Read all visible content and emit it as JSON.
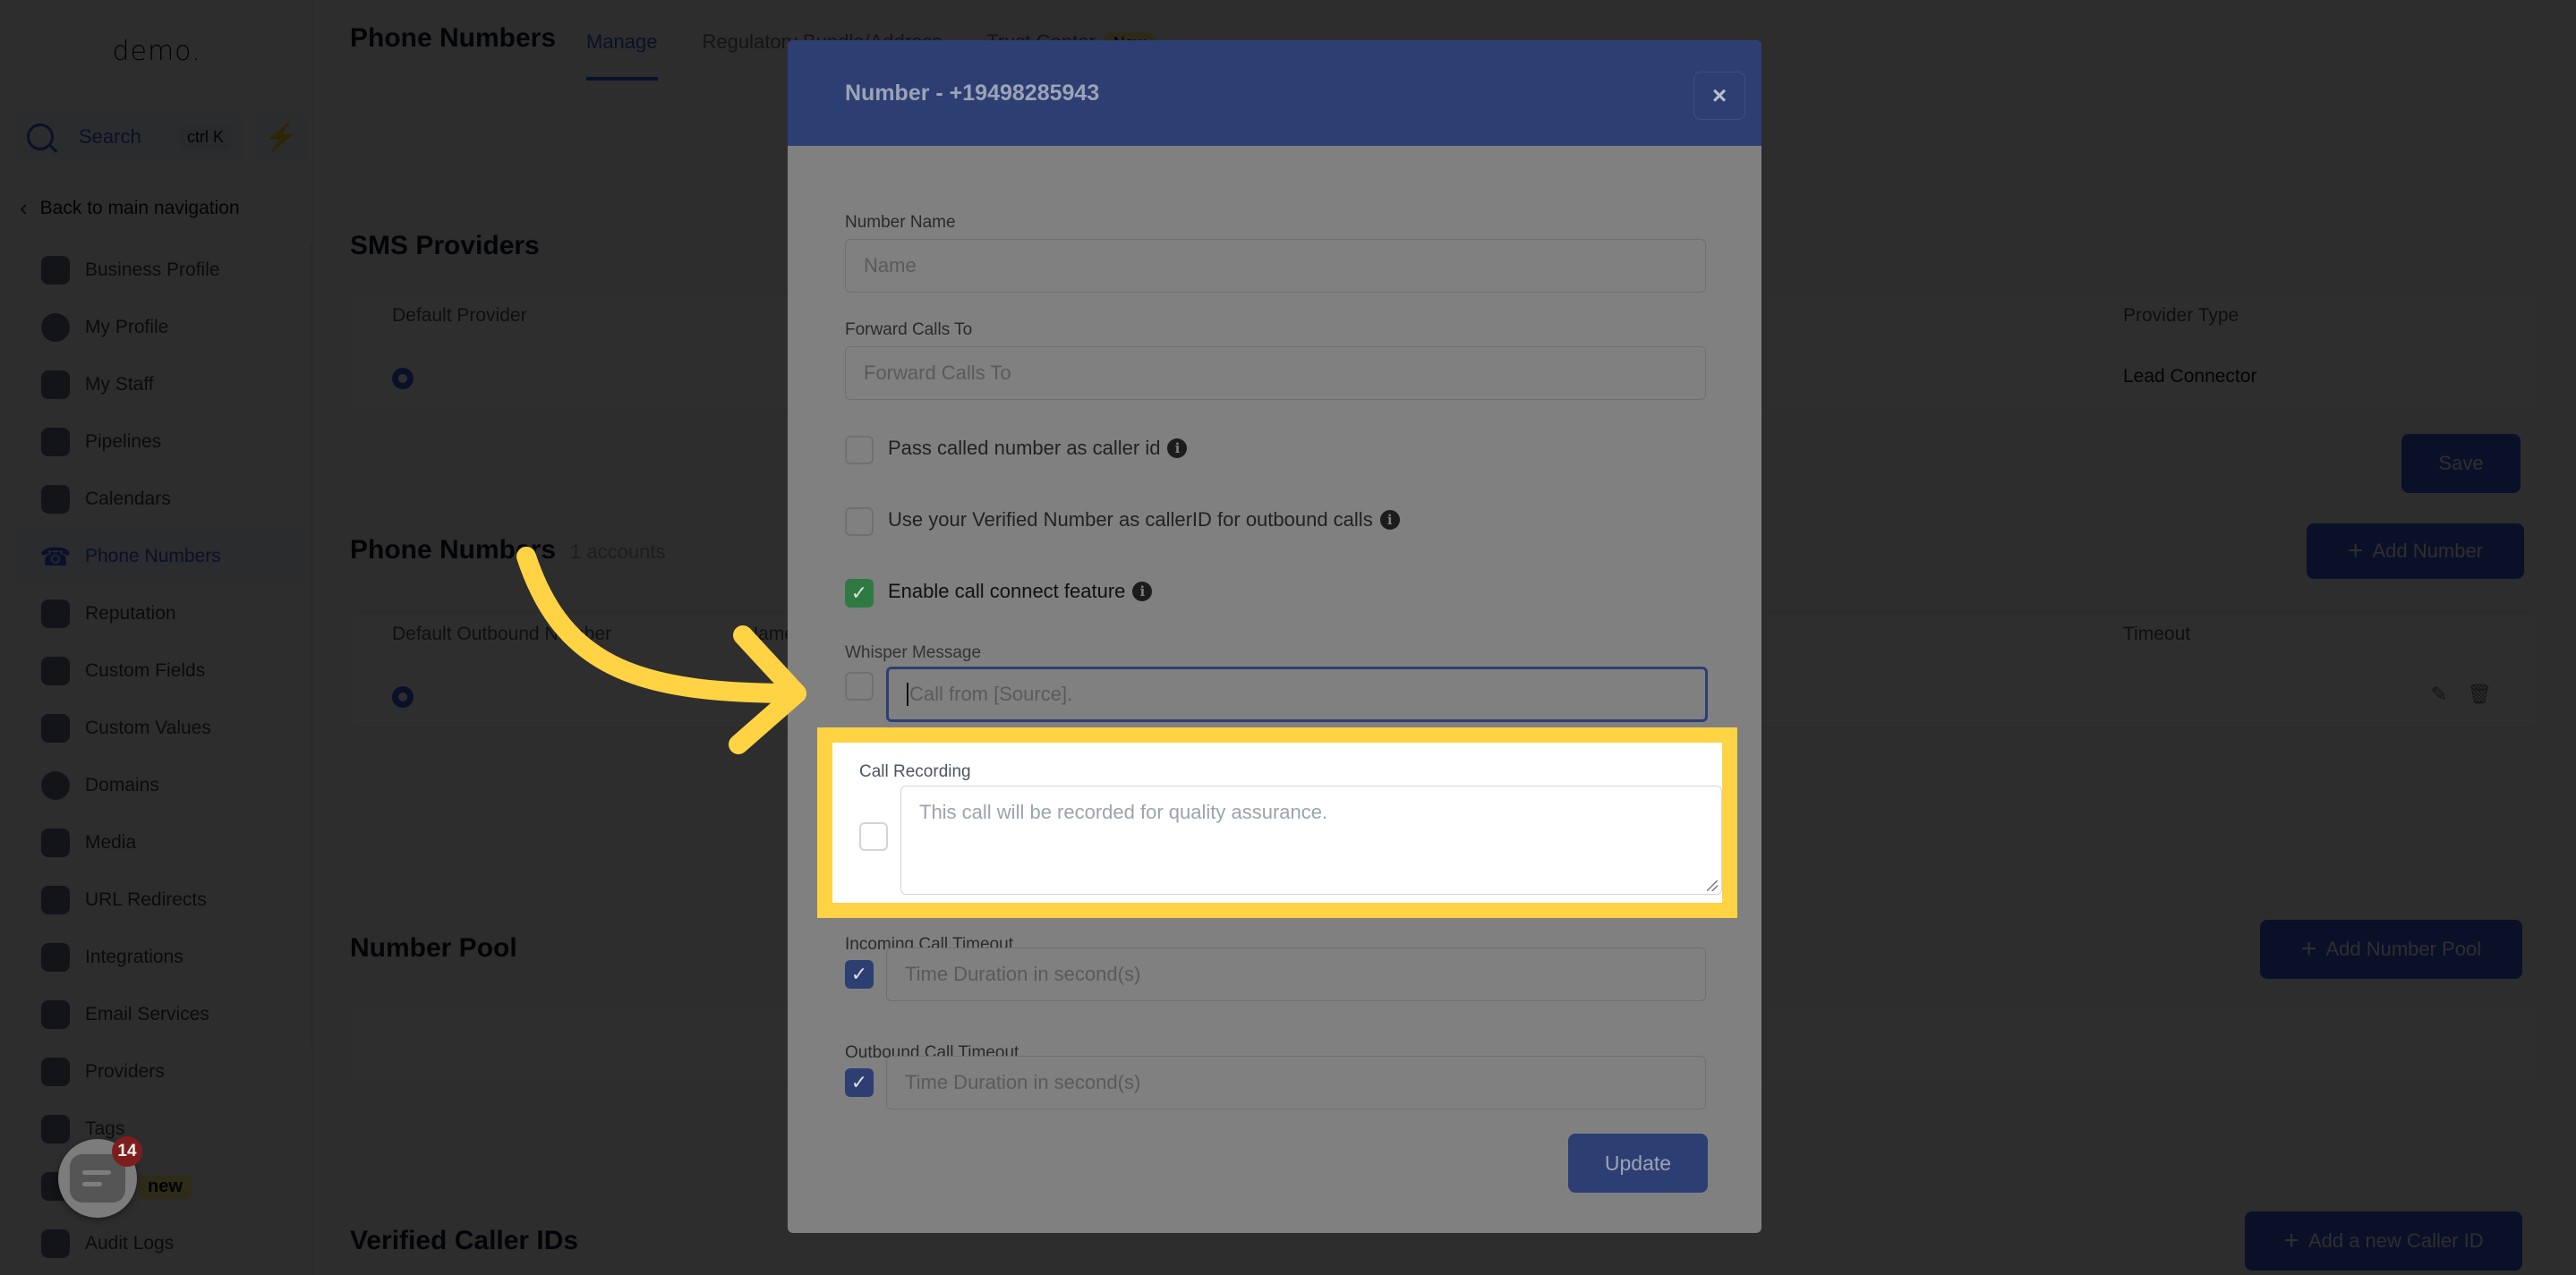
{
  "sidebar": {
    "logo": "demo.",
    "search": {
      "label": "Search",
      "shortcut": "ctrl K"
    },
    "back_label": "Back to main navigation",
    "items": [
      {
        "label": "Business Profile",
        "icon": "briefcase-icon"
      },
      {
        "label": "My Profile",
        "icon": "user-circle-icon"
      },
      {
        "label": "My Staff",
        "icon": "user-icon"
      },
      {
        "label": "Pipelines",
        "icon": "pipeline-icon"
      },
      {
        "label": "Calendars",
        "icon": "calendar-icon"
      },
      {
        "label": "Phone Numbers",
        "icon": "phone-icon",
        "active": true
      },
      {
        "label": "Reputation",
        "icon": "star-icon"
      },
      {
        "label": "Custom Fields",
        "icon": "custom-fields-icon"
      },
      {
        "label": "Custom Values",
        "icon": "diamond-icon"
      },
      {
        "label": "Domains",
        "icon": "globe-icon"
      },
      {
        "label": "Media",
        "icon": "media-icon"
      },
      {
        "label": "URL Redirects",
        "icon": "redirect-icon"
      },
      {
        "label": "Integrations",
        "icon": "integrations-icon"
      },
      {
        "label": "Email Services",
        "icon": "email-icon"
      },
      {
        "label": "Providers",
        "icon": "clipboard-check-icon"
      },
      {
        "label": "Tags",
        "icon": "tag-icon"
      },
      {
        "label": "",
        "icon": "flask-icon",
        "badge": "new"
      },
      {
        "label": "Audit Logs",
        "icon": "bar-chart-icon"
      }
    ]
  },
  "chat_widget": {
    "count": "14"
  },
  "header": {
    "title": "Phone Numbers",
    "tabs": [
      {
        "label": "Manage",
        "active": true
      },
      {
        "label": "Regulatory Bundle/Address"
      },
      {
        "label": "Trust Center",
        "badge": "New"
      }
    ]
  },
  "sms_providers": {
    "title": "SMS Providers",
    "columns": [
      "Default Provider",
      "Provider Type"
    ],
    "row": {
      "provider_type": "Lead Connector"
    },
    "save_label": "Save"
  },
  "phone_numbers": {
    "title": "Phone Numbers",
    "count": "1 accounts",
    "add_label": "Add Number",
    "columns": [
      "Default Outbound Number",
      "Name",
      "Timeout"
    ]
  },
  "number_pool": {
    "title": "Number Pool",
    "add_label": "Add Number Pool"
  },
  "verified_caller_ids": {
    "title": "Verified Caller IDs",
    "add_label": "Add a new Caller ID"
  },
  "modal": {
    "title": "Number - +19498285943",
    "close_label": "×",
    "number_name": {
      "label": "Number Name",
      "placeholder": "Name",
      "value": ""
    },
    "forward_calls": {
      "label": "Forward Calls To",
      "placeholder": "Forward Calls To",
      "value": ""
    },
    "pass_called_number": {
      "label": "Pass called number as caller id",
      "checked": false
    },
    "use_verified_number": {
      "label": "Use your Verified Number as callerID for outbound calls",
      "checked": false
    },
    "enable_call_connect": {
      "label": "Enable call connect feature",
      "checked": true
    },
    "whisper_message": {
      "label": "Whisper Message",
      "placeholder": "Call from [Source].",
      "checked": false
    },
    "call_recording": {
      "label": "Call Recording",
      "placeholder": "This call will be recorded for quality assurance.",
      "checked": false
    },
    "incoming_timeout": {
      "label": "Incoming Call Timeout",
      "placeholder": "Time Duration in second(s)",
      "checked": true
    },
    "outbound_timeout": {
      "label": "Outbound Call Timeout",
      "placeholder": "Time Duration in second(s)",
      "checked": true
    },
    "update_label": "Update"
  },
  "annotation": {
    "highlight_color": "#ffd343",
    "arrow_color": "#ffd343"
  }
}
